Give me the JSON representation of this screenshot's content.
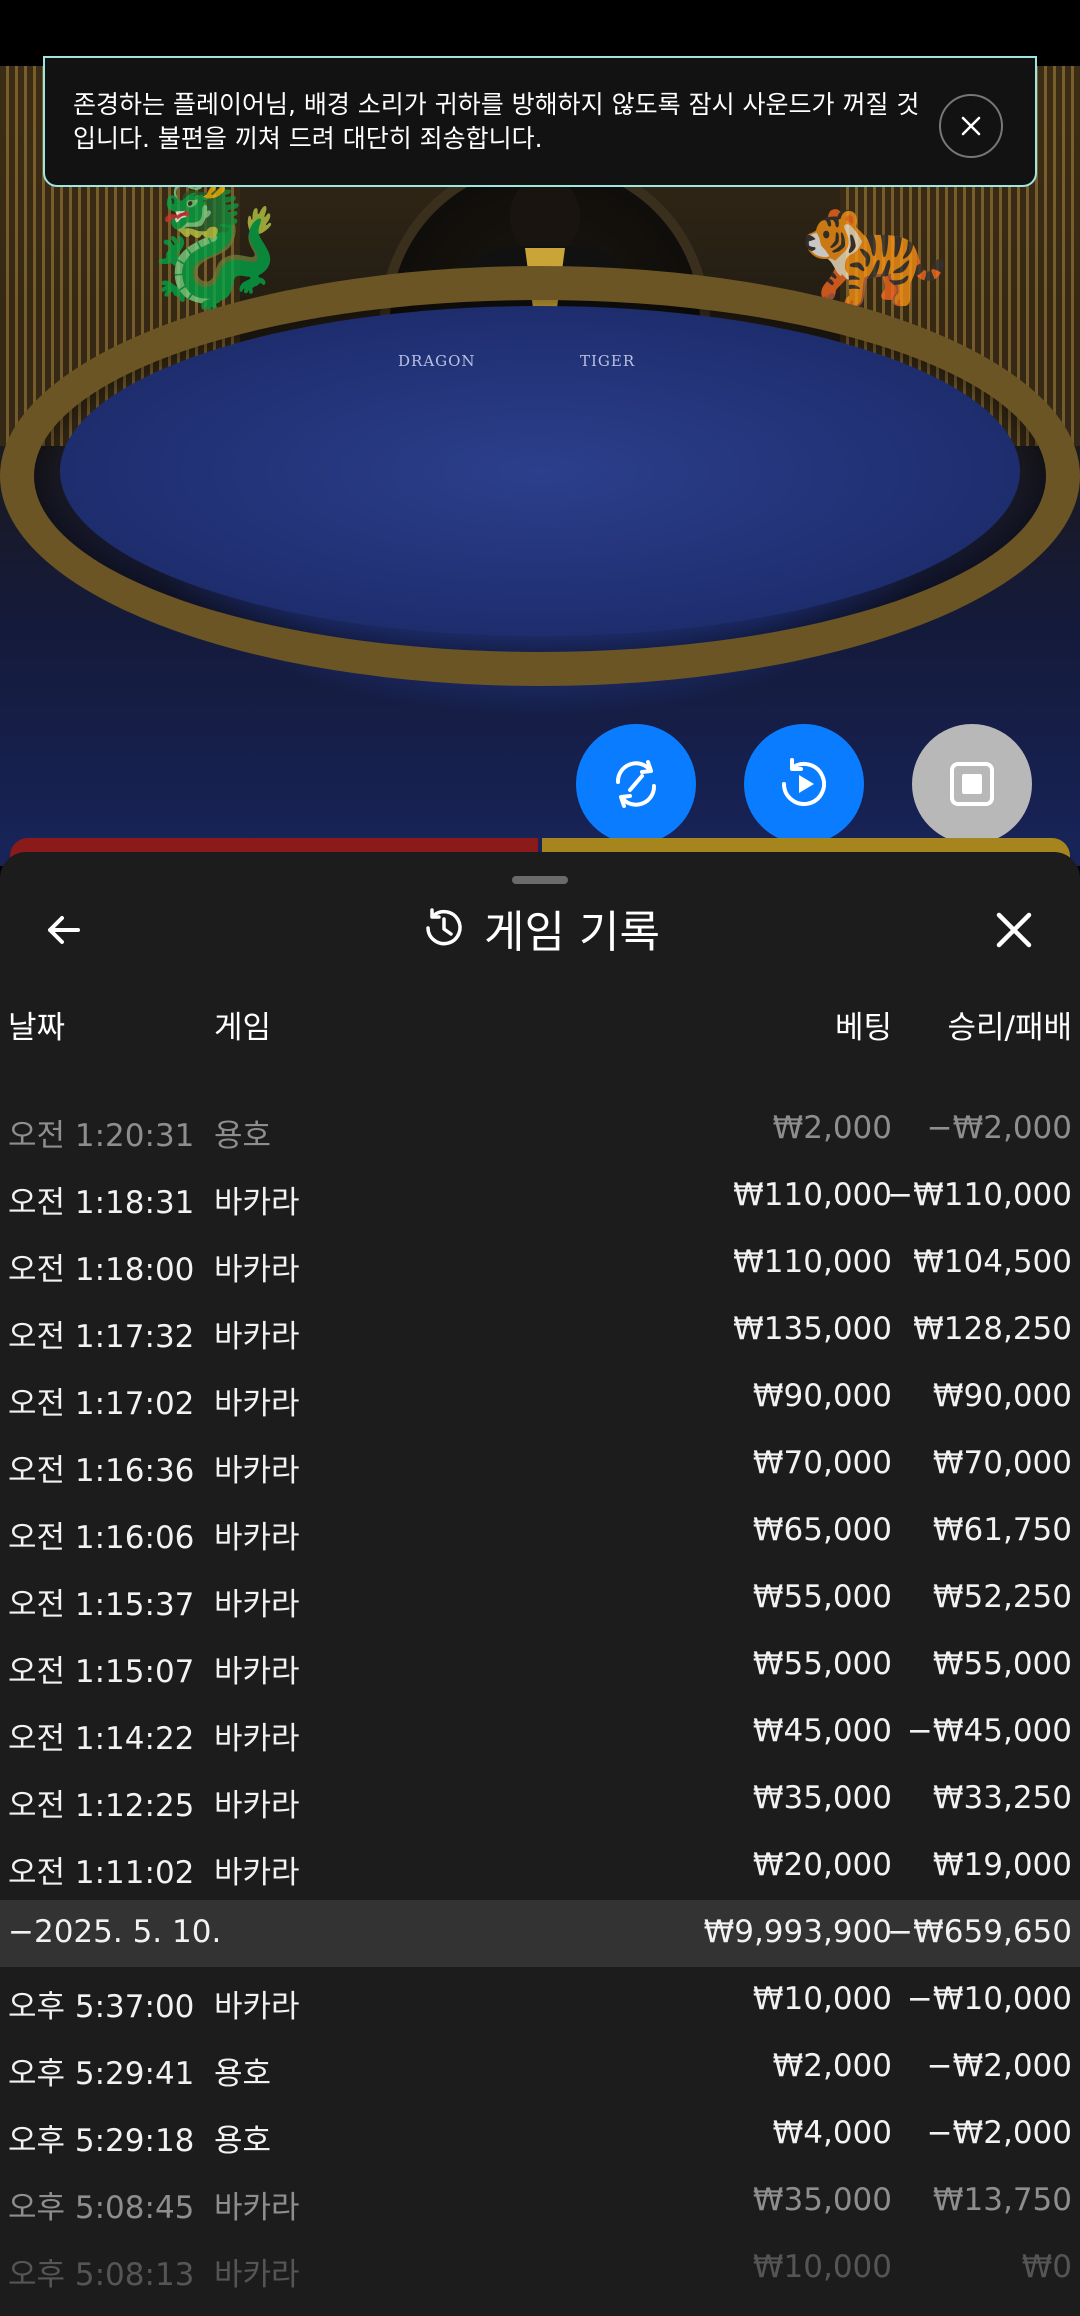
{
  "notice": {
    "message": "존경하는 플레이어님, 배경 소리가 귀하를 방해하지 않도록 잠시 사운드가 꺼질 것입니다. 불편을 끼쳐 드려 대단히 죄송합니다.",
    "close_icon": "close-icon"
  },
  "video": {
    "table_left_label": "DRAGON",
    "table_right_label": "TIGER"
  },
  "controls": [
    {
      "name": "rotate-view-icon",
      "color": "#0a7cff"
    },
    {
      "name": "replay-icon",
      "color": "#0a7cff"
    },
    {
      "name": "stop-icon",
      "color": "#b8b8b8"
    }
  ],
  "panel": {
    "title": "게임 기록",
    "back_icon": "arrow-left-icon",
    "history_icon": "history-icon",
    "close_icon": "close-icon",
    "columns": {
      "date": "날짜",
      "game": "게임",
      "bet": "베팅",
      "result": "승리/패배"
    },
    "rows": [
      {
        "date": "오전 1:20:31",
        "game": "용호",
        "bet": "₩2,000",
        "result": "−₩2,000",
        "style": "faded"
      },
      {
        "date": "오전 1:18:31",
        "game": "바카라",
        "bet": "₩110,000",
        "result": "−₩110,000",
        "style": "normal"
      },
      {
        "date": "오전 1:18:00",
        "game": "바카라",
        "bet": "₩110,000",
        "result": "₩104,500",
        "style": "normal"
      },
      {
        "date": "오전 1:17:32",
        "game": "바카라",
        "bet": "₩135,000",
        "result": "₩128,250",
        "style": "normal"
      },
      {
        "date": "오전 1:17:02",
        "game": "바카라",
        "bet": "₩90,000",
        "result": "₩90,000",
        "style": "normal"
      },
      {
        "date": "오전 1:16:36",
        "game": "바카라",
        "bet": "₩70,000",
        "result": "₩70,000",
        "style": "normal"
      },
      {
        "date": "오전 1:16:06",
        "game": "바카라",
        "bet": "₩65,000",
        "result": "₩61,750",
        "style": "normal"
      },
      {
        "date": "오전 1:15:37",
        "game": "바카라",
        "bet": "₩55,000",
        "result": "₩52,250",
        "style": "normal"
      },
      {
        "date": "오전 1:15:07",
        "game": "바카라",
        "bet": "₩55,000",
        "result": "₩55,000",
        "style": "normal"
      },
      {
        "date": "오전 1:14:22",
        "game": "바카라",
        "bet": "₩45,000",
        "result": "−₩45,000",
        "style": "normal"
      },
      {
        "date": "오전 1:12:25",
        "game": "바카라",
        "bet": "₩35,000",
        "result": "₩33,250",
        "style": "normal"
      },
      {
        "date": "오전 1:11:02",
        "game": "바카라",
        "bet": "₩20,000",
        "result": "₩19,000",
        "style": "normal"
      },
      {
        "date": "−2025. 5. 10.",
        "game": "",
        "bet": "₩9,993,900",
        "result": "−₩659,650",
        "style": "summary"
      },
      {
        "date": "오후 5:37:00",
        "game": "바카라",
        "bet": "₩10,000",
        "result": "−₩10,000",
        "style": "normal"
      },
      {
        "date": "오후 5:29:41",
        "game": "용호",
        "bet": "₩2,000",
        "result": "−₩2,000",
        "style": "normal"
      },
      {
        "date": "오후 5:29:18",
        "game": "용호",
        "bet": "₩4,000",
        "result": "−₩2,000",
        "style": "normal"
      },
      {
        "date": "오후 5:08:45",
        "game": "바카라",
        "bet": "₩35,000",
        "result": "₩13,750",
        "style": "faded"
      },
      {
        "date": "오후 5:08:13",
        "game": "바카라",
        "bet": "₩10,000",
        "result": "₩0",
        "style": "faded2"
      }
    ]
  }
}
